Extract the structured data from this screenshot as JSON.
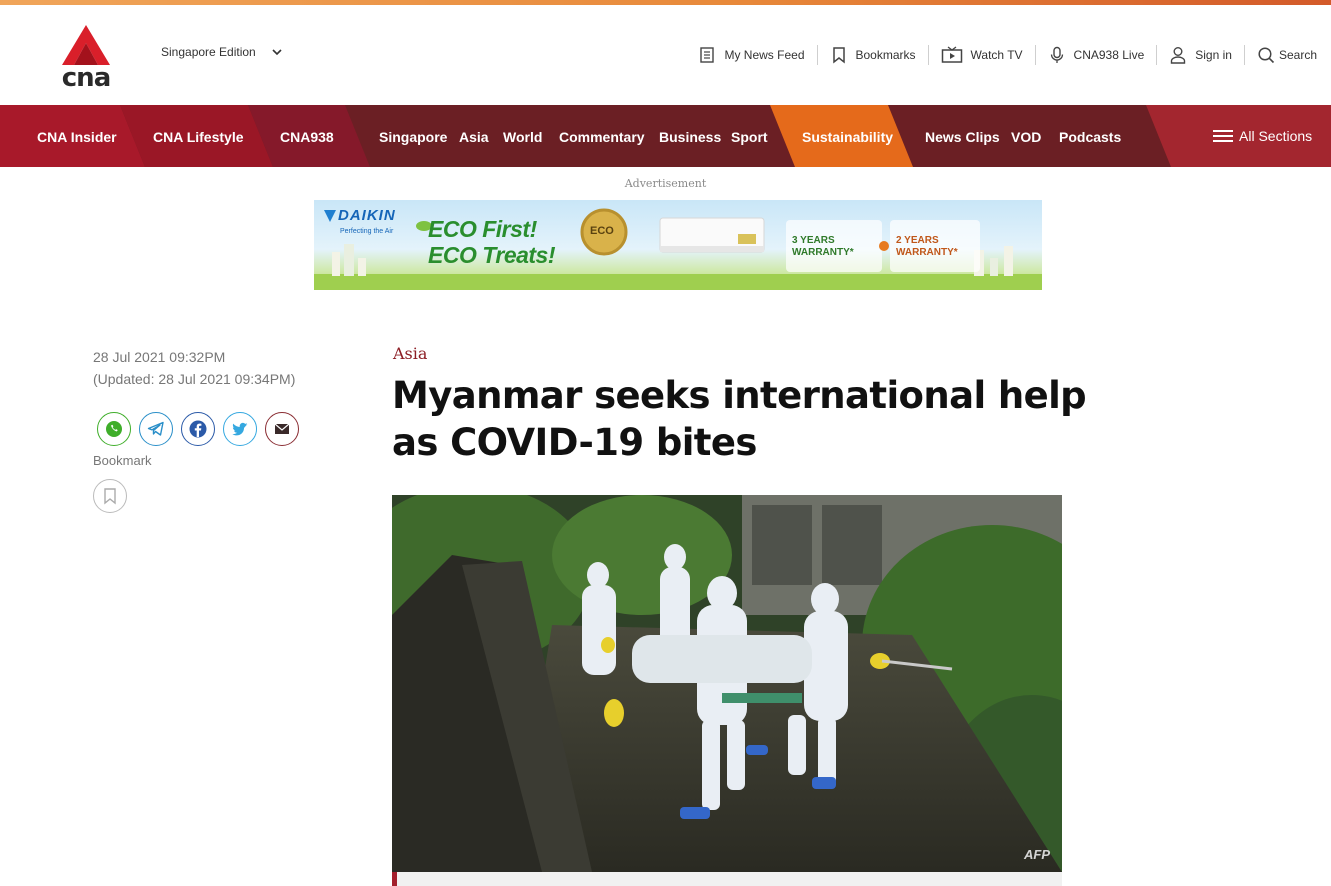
{
  "header": {
    "logo_text": "cna",
    "edition_label": "Singapore Edition",
    "utility": [
      {
        "label": "My News Feed",
        "icon": "news-feed-icon"
      },
      {
        "label": "Bookmarks",
        "icon": "bookmark-icon"
      },
      {
        "label": "Watch TV",
        "icon": "tv-icon"
      },
      {
        "label": "CNA938 Live",
        "icon": "microphone-icon"
      },
      {
        "label": "Sign in",
        "icon": "user-icon"
      },
      {
        "label": "Search",
        "icon": "search-icon"
      }
    ]
  },
  "nav": {
    "items": [
      "CNA Insider",
      "CNA Lifestyle",
      "CNA938",
      "Singapore",
      "Asia",
      "World",
      "Commentary",
      "Business",
      "Sport",
      "Sustainability",
      "News Clips",
      "VOD",
      "Podcasts"
    ],
    "all_sections": "All Sections",
    "colors": {
      "base": "#6b1f24",
      "insider": "#a8192a",
      "lifestyle": "#9a1726",
      "cna938": "#85192a",
      "sustainability": "#e56a1b",
      "all_sections": "#a3262f"
    }
  },
  "ad": {
    "label": "Advertisement",
    "brand": "DAIKIN",
    "tagline": "Perfecting the Air",
    "headline_1": "ECO First!",
    "headline_2": "ECO Treats!",
    "badge": "ECO",
    "warranty_1": "3 YEARS WARRANTY*",
    "warranty_2": "2 YEARS WARRANTY*"
  },
  "article": {
    "published": "28 Jul 2021 09:32PM",
    "updated": "(Updated: 28 Jul 2021 09:34PM)",
    "bookmark_label": "Bookmark",
    "category": "Asia",
    "headline": "Myanmar seeks international help as COVID-19 bites",
    "image_credit": "AFP",
    "share": [
      {
        "name": "whatsapp",
        "color": "#3fae2a"
      },
      {
        "name": "telegram",
        "color": "#2a8fc9"
      },
      {
        "name": "facebook",
        "color": "#2b5aa8"
      },
      {
        "name": "twitter",
        "color": "#35a8e0"
      },
      {
        "name": "email",
        "color": "#8a2d33"
      }
    ]
  }
}
